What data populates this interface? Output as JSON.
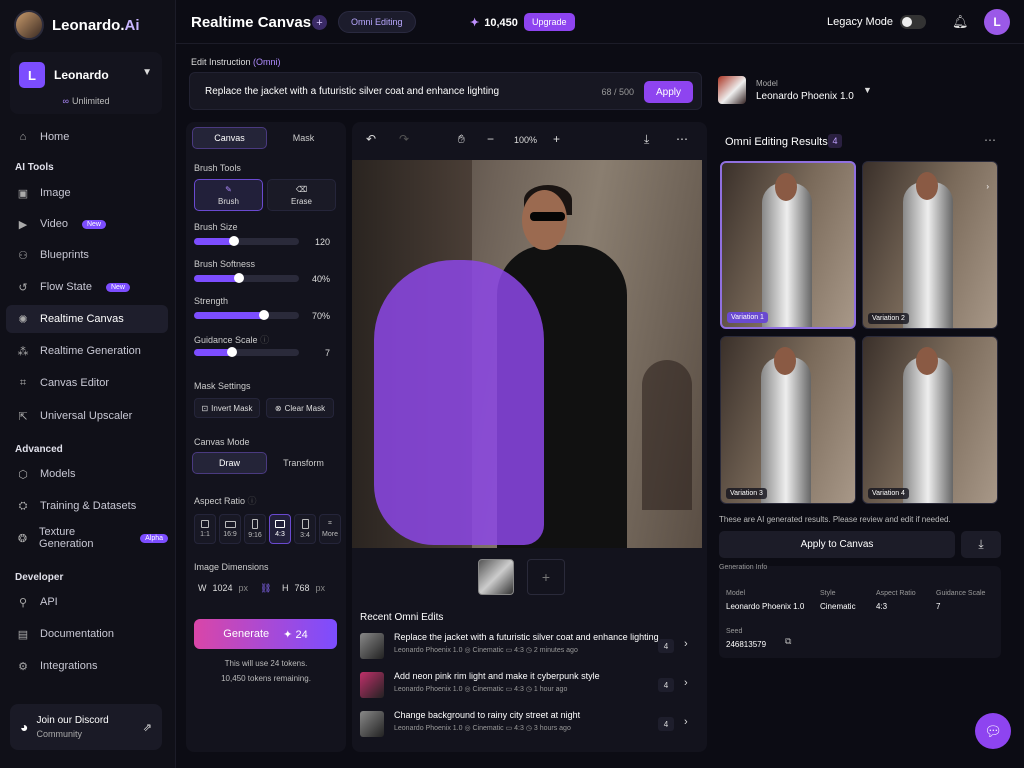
{
  "app": {
    "name_main": "Leonardo.",
    "name_suffix": "Ai"
  },
  "user": {
    "initial": "L",
    "name": "Leonardo",
    "plan": "Unlimited"
  },
  "nav": {
    "home": "Home",
    "ai_tools_head": "AI Tools",
    "image": "Image",
    "video": "Video",
    "video_badge": "New",
    "blueprints": "Blueprints",
    "flow_state": "Flow State",
    "flow_badge": "New",
    "realtime_canvas": "Realtime Canvas",
    "realtime_generation": "Realtime Generation",
    "canvas_editor": "Canvas Editor",
    "universal_upscaler": "Universal Upscaler",
    "advanced_head": "Advanced",
    "models": "Models",
    "training": "Training & Datasets",
    "texture": "Texture Generation",
    "texture_badge": "Alpha",
    "developer_head": "Developer",
    "api": "API",
    "documentation": "Documentation",
    "integrations": "Integrations"
  },
  "discord": {
    "title": "Join our Discord",
    "subtitle": "Community"
  },
  "topbar": {
    "title": "Realtime Canvas",
    "mode_pill": "Omni Editing",
    "tokens": "10,450",
    "upgrade": "Upgrade",
    "legacy_mode": "Legacy Mode",
    "avatar_initial": "L"
  },
  "instruction": {
    "label": "Edit Instruction",
    "label_tag": "(Omni)",
    "text": "Replace the jacket with a futuristic silver coat and enhance lighting",
    "count": "68 / 500",
    "apply": "Apply"
  },
  "model": {
    "label": "Model",
    "name": "Leonardo Phoenix 1.0"
  },
  "tools": {
    "tab_canvas": "Canvas",
    "tab_mask": "Mask",
    "brush_tools": "Brush Tools",
    "brush": "Brush",
    "erase": "Erase",
    "brush_size_label": "Brush Size",
    "brush_size": "120",
    "brush_size_pct": 0.38,
    "brush_softness_label": "Brush Softness",
    "brush_softness": "40%",
    "brush_softness_pct": 0.43,
    "strength_label": "Strength",
    "strength": "70%",
    "strength_pct": 0.67,
    "guidance_label": "Guidance Scale",
    "guidance": "7",
    "guidance_pct": 0.36,
    "mask_settings": "Mask Settings",
    "invert_mask": "Invert Mask",
    "clear_mask": "Clear Mask",
    "canvas_mode": "Canvas Mode",
    "mode_draw": "Draw",
    "mode_transform": "Transform",
    "aspect_ratio": "Aspect Ratio",
    "ar_1_1": "1:1",
    "ar_16_9": "16:9",
    "ar_9_16": "9:16",
    "ar_4_3": "4:3",
    "ar_3_4": "3:4",
    "ar_more": "More",
    "image_dims": "Image Dimensions",
    "w_label": "W",
    "w_value": "1024",
    "h_label": "H",
    "h_value": "768",
    "unit": "px",
    "generate": "Generate",
    "generate_cost": "24",
    "note1": "This will use 24 tokens.",
    "note2": "10,450 tokens remaining."
  },
  "canvas": {
    "zoom": "100%",
    "recent_title": "Recent Omni Edits",
    "recent": [
      {
        "text": "Replace the jacket with a futuristic silver coat and enhance lighting",
        "model": "Leonardo Phoenix 1.0",
        "style": "Cinematic",
        "ratio": "4:3",
        "time": "2 minutes ago",
        "count": "4"
      },
      {
        "text": "Add neon pink rim light and make it cyberpunk style",
        "model": "Leonardo Phoenix 1.0",
        "style": "Cinematic",
        "ratio": "4:3",
        "time": "1 hour ago",
        "count": "4"
      },
      {
        "text": "Change background to rainy city street at night",
        "model": "Leonardo Phoenix 1.0",
        "style": "Cinematic",
        "ratio": "4:3",
        "time": "3 hours ago",
        "count": "4"
      }
    ]
  },
  "results": {
    "title": "Omni Editing Results",
    "count": "4",
    "variations": [
      "Variation 1",
      "Variation 2",
      "Variation 3",
      "Variation 4"
    ],
    "note": "These are AI generated results. Please review and edit if needed.",
    "apply_to_canvas": "Apply to Canvas",
    "gen_info_title": "Generation Info",
    "info_model_label": "Model",
    "info_model": "Leonardo Phoenix 1.0",
    "info_style_label": "Style",
    "info_style": "Cinematic",
    "info_ratio_label": "Aspect Ratio",
    "info_ratio": "4:3",
    "info_guidance_label": "Guidance Scale",
    "info_guidance": "7",
    "info_seed_label": "Seed",
    "info_seed": "246813579"
  },
  "colors": {
    "accent": "#8e44f0",
    "mask": "#8c46e6",
    "bg": "#0c0c14"
  }
}
